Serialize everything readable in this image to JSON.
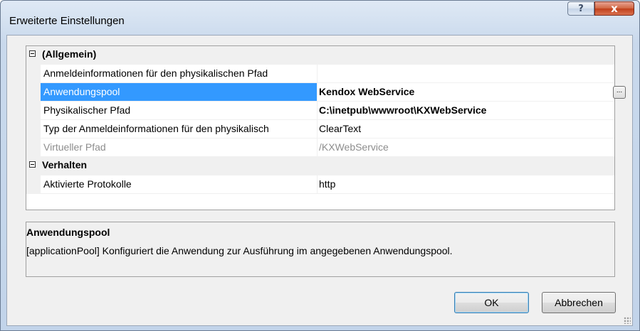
{
  "window": {
    "title": "Erweiterte Einstellungen",
    "help_label": "?",
    "close_label": "x"
  },
  "grid": {
    "categories": [
      {
        "label": "(Allgemein)",
        "properties": [
          {
            "name": "Anmeldeinformationen für den physikalischen Pfad",
            "value": ""
          },
          {
            "name": "Anwendungspool",
            "value": "Kendox WebService",
            "selected": true,
            "bold": true,
            "has_ellipsis": true
          },
          {
            "name": "Physikalischer Pfad",
            "value": "C:\\inetpub\\wwwroot\\KXWebService",
            "bold": true
          },
          {
            "name": "Typ der Anmeldeinformationen für den physikalisch",
            "value": "ClearText"
          },
          {
            "name": "Virtueller Pfad",
            "value": "/KXWebService",
            "disabled": true
          }
        ]
      },
      {
        "label": "Verhalten",
        "properties": [
          {
            "name": "Aktivierte Protokolle",
            "value": "http"
          }
        ]
      }
    ],
    "ellipsis_label": "..."
  },
  "description": {
    "title": "Anwendungspool",
    "text": "[applicationPool] Konfiguriert die Anwendung zur Ausführung im angegebenen Anwendungspool."
  },
  "buttons": {
    "ok_label": "OK",
    "cancel_label": "Abbrechen"
  },
  "colors": {
    "selection": "#3399ff",
    "close_button": "#c0401b"
  }
}
